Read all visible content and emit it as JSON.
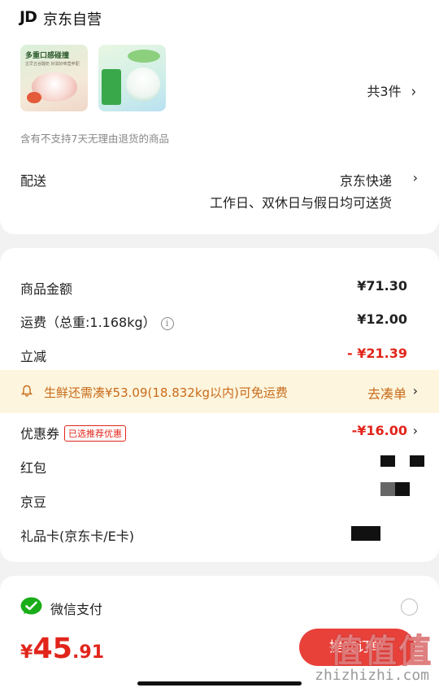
{
  "store": {
    "logo_text": "JD",
    "name": "京东自营",
    "count_text": "共3件",
    "notice": "含有不支持7天无理由退货的商品",
    "thumb1_tag": "多重口感碰撞",
    "thumb1_sub": "古早五谷酸奶 好滋好味营养配"
  },
  "shipping": {
    "label": "配送",
    "method": "京东快递",
    "description": "工作日、双休日与假日均可送货"
  },
  "summary": {
    "goods_label": "商品金额",
    "goods_value": "¥71.30",
    "freight_label": "运费（总重:1.168kg）",
    "freight_value": "¥12.00",
    "discount_label": "立减",
    "discount_value": "- ¥21.39",
    "banner_text": "生鲜还需凑¥53.09(18.832kg以内)可免运费",
    "banner_link": "去凑单",
    "coupon_label": "优惠券",
    "coupon_tag": "已选推荐优惠",
    "coupon_value": "-¥16.00",
    "redpacket_label": "红包",
    "jingdou_label": "京豆",
    "giftcard_label": "礼品卡(京东卡/E卡)"
  },
  "payment": {
    "method": "微信支付",
    "total_currency": "¥",
    "total_int": "45",
    "total_dec": ".91",
    "submit_label": "提交订单"
  },
  "watermark": {
    "text": "值值值",
    "url": "zhizhizhi.com"
  },
  "colors": {
    "accent_red": "#e1251b",
    "banner_bg": "#fdf5dd",
    "banner_text": "#c86b1b",
    "wechat_green": "#1aad19"
  }
}
